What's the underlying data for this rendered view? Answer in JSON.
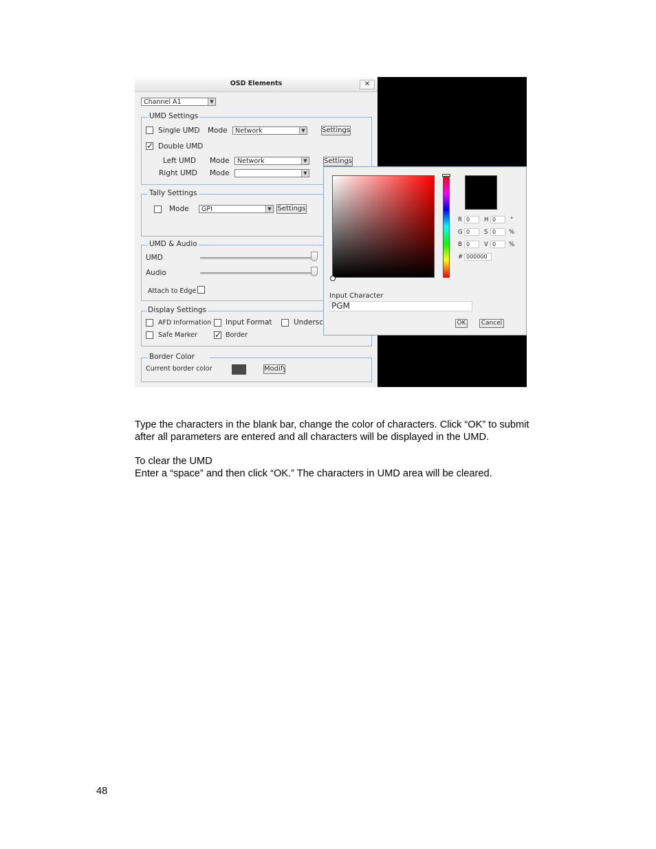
{
  "dialog": {
    "title": "OSD Elements",
    "close_symbol": "✕",
    "channel_select": "Channel A1",
    "umd_settings": {
      "legend": "UMD Settings",
      "single_umd": "Single UMD",
      "mode": "Mode",
      "single_mode_value": "Network",
      "settings_btn": "Settings",
      "double_umd": "Double UMD",
      "left_umd": "Left UMD",
      "left_mode_value": "Network",
      "right_umd": "Right UMD",
      "right_mode_value": ""
    },
    "tally_settings": {
      "legend": "Tally Settings",
      "mode": "Mode",
      "mode_value": "GPI",
      "settings_btn": "Settings"
    },
    "umd_audio": {
      "legend": "UMD & Audio",
      "umd": "UMD",
      "audio": "Audio",
      "attach_to_edge": "Attach to Edge"
    },
    "display_settings": {
      "legend": "Display Settings",
      "afd_information": "AFD Information",
      "input_format": "Input Format",
      "underscan": "Undersca",
      "safe_marker": "Safe Marker",
      "border": "Border"
    },
    "border_color": {
      "legend": "Border Color",
      "current": "Current border color",
      "current_color": "#4a4a4a",
      "modify_btn": "Modify"
    }
  },
  "picker": {
    "r_label": "R",
    "r_value": "0",
    "g_label": "G",
    "g_value": "0",
    "b_label": "B",
    "b_value": "0",
    "h_label": "H",
    "h_value": "0",
    "h_unit": "°",
    "s_label": "S",
    "s_value": "0",
    "s_unit": "%",
    "v_label": "V",
    "v_value": "0",
    "v_unit": "%",
    "hash_label": "#",
    "hex_value": "000000",
    "input_character_label": "Input Character",
    "input_character_value": "PGM",
    "ok_btn": "OK",
    "cancel_btn": "Cancel",
    "selected_color": "#000000"
  },
  "text": {
    "para1_line1": "Type the characters in the blank bar, change the color of characters. Click “OK” to submit",
    "para1_line2": "after all parameters are entered and all characters will be displayed in the UMD.",
    "para2_line1": "To clear the UMD",
    "para2_line2": "Enter a “space” and then click “OK.”  The characters in UMD area will be cleared."
  },
  "page_number": "48"
}
